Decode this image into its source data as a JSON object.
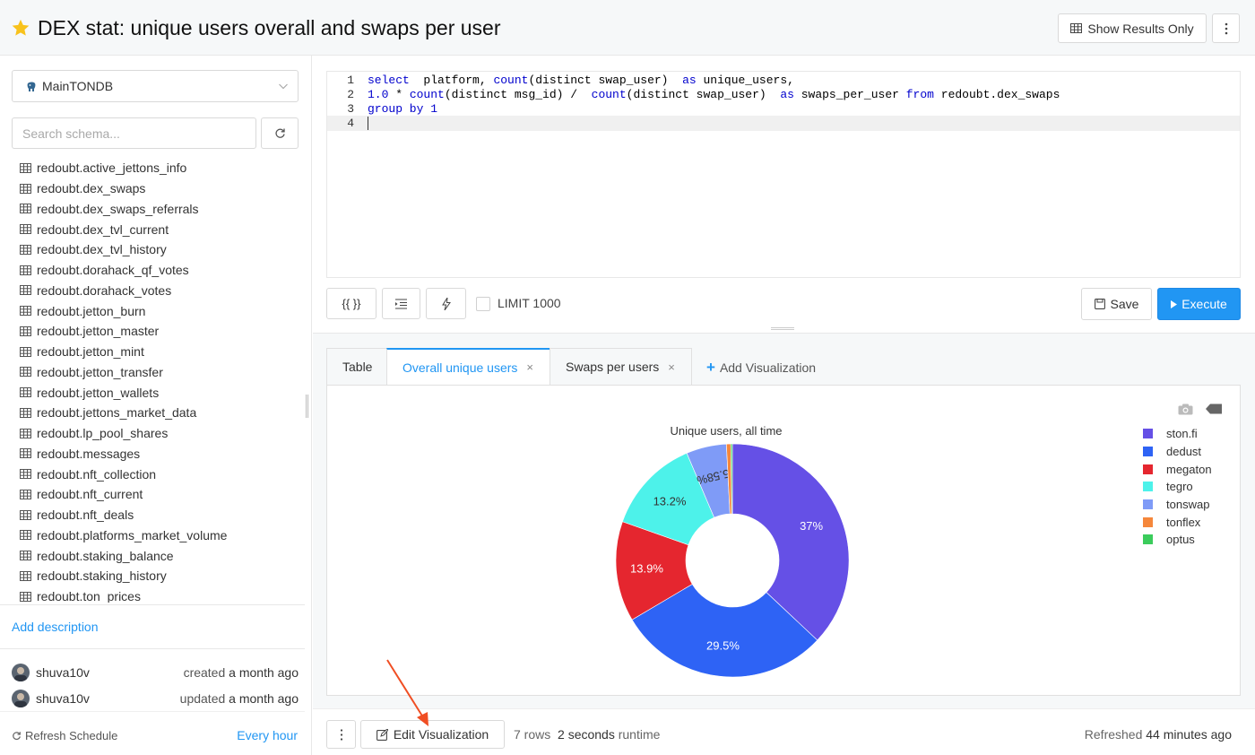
{
  "header": {
    "title": "DEX stat: unique users overall and swaps per user",
    "show_results_label": "Show Results Only"
  },
  "sidebar": {
    "data_source": "MainTONDB",
    "search_placeholder": "Search schema...",
    "tables": [
      "redoubt.active_jettons_info",
      "redoubt.dex_swaps",
      "redoubt.dex_swaps_referrals",
      "redoubt.dex_tvl_current",
      "redoubt.dex_tvl_history",
      "redoubt.dorahack_qf_votes",
      "redoubt.dorahack_votes",
      "redoubt.jetton_burn",
      "redoubt.jetton_master",
      "redoubt.jetton_mint",
      "redoubt.jetton_transfer",
      "redoubt.jetton_wallets",
      "redoubt.jettons_market_data",
      "redoubt.lp_pool_shares",
      "redoubt.messages",
      "redoubt.nft_collection",
      "redoubt.nft_current",
      "redoubt.nft_deals",
      "redoubt.platforms_market_volume",
      "redoubt.staking_balance",
      "redoubt.staking_history",
      "redoubt.ton_prices"
    ],
    "add_description": "Add description",
    "created": {
      "user": "shuva10v",
      "verb": "created",
      "when": "a month ago"
    },
    "updated": {
      "user": "shuva10v",
      "verb": "updated",
      "when": "a month ago"
    },
    "refresh_schedule_label": "Refresh Schedule",
    "refresh_schedule_value": "Every hour"
  },
  "editor": {
    "lines": [
      {
        "n": "1"
      },
      {
        "n": "2"
      },
      {
        "n": "3"
      },
      {
        "n": "4"
      }
    ],
    "tokens": {
      "select": "select",
      "l1_cols": "  platform, ",
      "count": "count",
      "l1_distinct": "(distinct swap_user)  ",
      "as": "as",
      "l1_alias": " unique_users,",
      "num10": "1.0",
      "l2_star": " * ",
      "l2_distinct1": "(distinct msg_id) /  ",
      "l2_distinct2": "(distinct swap_user)  ",
      "l2_alias": " swaps_per_user ",
      "from": "from",
      "l2_table": " redoubt.dex_swaps",
      "groupby": "group by",
      "num1": "1"
    }
  },
  "toolbar": {
    "params_label": "{{ }}",
    "limit_label": "LIMIT 1000",
    "save_label": "Save",
    "execute_label": "Execute"
  },
  "tabs": [
    {
      "label": "Table"
    },
    {
      "label": "Overall unique users",
      "close": "×"
    },
    {
      "label": "Swaps per users",
      "close": "×"
    }
  ],
  "add_visualization": "Add Visualization",
  "chart_data": {
    "type": "pie",
    "title": "Unique users, all time",
    "donut": true,
    "categories": [
      "ston.fi",
      "dedust",
      "megaton",
      "tegro",
      "tonswap",
      "tonflex",
      "optus"
    ],
    "values": [
      37.0,
      29.5,
      13.9,
      13.2,
      5.58,
      0.6,
      0.22
    ],
    "labels": [
      "37%",
      "29.5%",
      "13.9%",
      "13.2%",
      "5.58%",
      "",
      ""
    ],
    "colors": [
      "#6550e6",
      "#2e63f5",
      "#e5262f",
      "#4df2ea",
      "#7f9bf7",
      "#f5873b",
      "#3bcc5c"
    ],
    "legend_position": "top-right"
  },
  "footer": {
    "edit_viz_label": "Edit Visualization",
    "rows": "7 rows",
    "runtime_value": "2 seconds",
    "runtime_suffix": "runtime",
    "refreshed_prefix": "Refreshed",
    "refreshed_value": "44 minutes ago"
  }
}
